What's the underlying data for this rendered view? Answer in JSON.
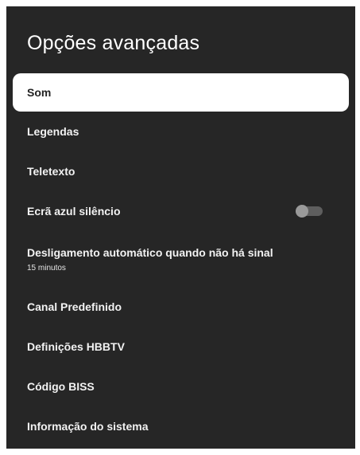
{
  "header": {
    "title": "Opções avançadas"
  },
  "menu": {
    "items": [
      {
        "label": "Som",
        "focused": true
      },
      {
        "label": "Legendas"
      },
      {
        "label": "Teletexto"
      },
      {
        "label": "Ecrã azul silêncio",
        "toggle": "off"
      },
      {
        "label": "Desligamento automático quando não há sinal",
        "sub": "15 minutos"
      },
      {
        "label": "Canal Predefinido"
      },
      {
        "label": "Definições HBBTV"
      },
      {
        "label": "Código BISS"
      },
      {
        "label": "Informação do sistema"
      }
    ]
  },
  "colors": {
    "panel_bg": "#262626",
    "focus_bg": "#ffffff",
    "toggle_track": "#5e5e5e",
    "toggle_knob": "#9a9a9a"
  }
}
